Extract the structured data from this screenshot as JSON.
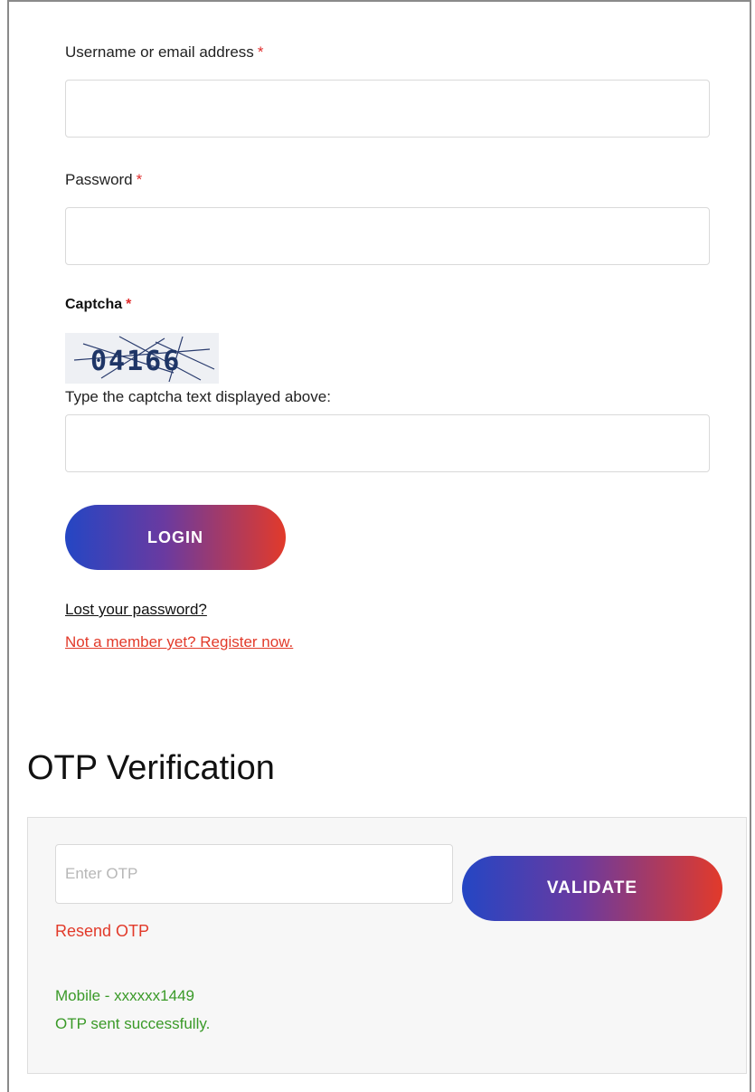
{
  "login": {
    "username_label": "Username or email address",
    "password_label": "Password",
    "required_mark": "*",
    "captcha_label": "Captcha",
    "captcha_text": "04166",
    "captcha_hint": "Type the captcha text displayed above:",
    "login_button": "LOGIN",
    "lost_password": "Lost your password?",
    "register_link": "Not a member yet? Register now."
  },
  "otp": {
    "title": "OTP Verification",
    "input_placeholder": "Enter OTP",
    "validate_button": "VALIDATE",
    "resend": "Resend OTP",
    "mobile": "Mobile - xxxxxx1449",
    "status": "OTP sent successfully."
  },
  "colors": {
    "required": "#e02d2d",
    "gradient_start": "#2446c4",
    "gradient_end": "#e23a2a",
    "success": "#3a9a28"
  }
}
